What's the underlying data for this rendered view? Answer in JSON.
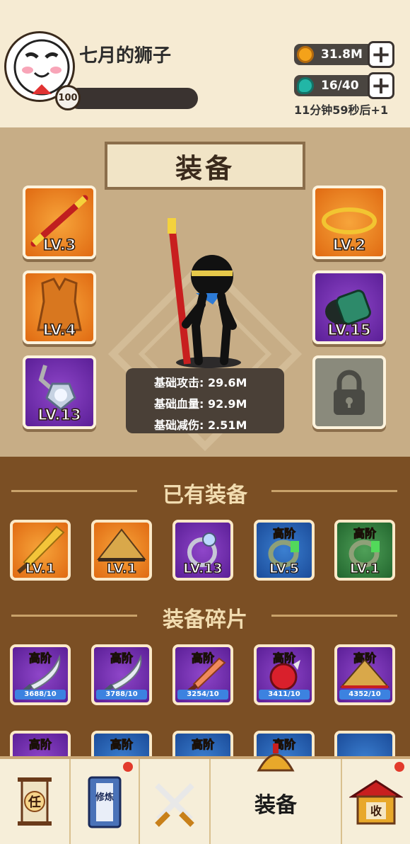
{
  "player": {
    "name": "七月的狮子",
    "level": "100"
  },
  "resources": {
    "coins": "31.8M",
    "energy": "16/40",
    "regen_timer": "11分钟59秒后+1"
  },
  "equip_panel": {
    "title": "装备",
    "slots_left": [
      {
        "name": "staff",
        "level": "LV.3",
        "rarity": "orange"
      },
      {
        "name": "armor",
        "level": "LV.4",
        "rarity": "orange"
      },
      {
        "name": "necklace",
        "level": "LV.13",
        "rarity": "purple"
      }
    ],
    "slots_right": [
      {
        "name": "headband",
        "level": "LV.2",
        "rarity": "orange"
      },
      {
        "name": "bracer",
        "level": "LV.15",
        "rarity": "purple"
      }
    ],
    "stats": {
      "attack": "基础攻击: 29.6M",
      "health": "基础血量: 92.9M",
      "defense": "基础减伤: 2.51M"
    }
  },
  "owned_equipment": {
    "title": "已有装备",
    "items": [
      {
        "icon": "sword-icon",
        "level": "LV.1",
        "rarity": "orange",
        "tier": ""
      },
      {
        "icon": "hat-icon",
        "level": "LV.1",
        "rarity": "orange",
        "tier": ""
      },
      {
        "icon": "ring-icon",
        "level": "LV.13",
        "rarity": "purple",
        "tier": ""
      },
      {
        "icon": "bracelet-icon",
        "level": "LV.5",
        "rarity": "blue",
        "tier": "高阶"
      },
      {
        "icon": "bracelet-icon",
        "level": "LV.1",
        "rarity": "green",
        "tier": "高阶"
      }
    ]
  },
  "fragments": {
    "title": "装备碎片",
    "items": [
      {
        "icon": "blade-icon",
        "tier": "高阶",
        "progress": "3688/10"
      },
      {
        "icon": "blade-icon",
        "tier": "高阶",
        "progress": "3788/10"
      },
      {
        "icon": "sword-icon",
        "tier": "高阶",
        "progress": "3254/10"
      },
      {
        "icon": "gauntlet-icon",
        "tier": "高阶",
        "progress": "3411/10"
      },
      {
        "icon": "hat-icon",
        "tier": "高阶",
        "progress": "4352/10"
      }
    ],
    "partial_row_tiers": [
      "高阶",
      "高阶",
      "高阶",
      "高阶"
    ]
  },
  "nav": {
    "task_label": "任",
    "cultivate_label": "修炼",
    "equip_label": "装备",
    "collect_label": "收"
  },
  "colors": {
    "panel": "#c7ad86",
    "inventory": "#7b4f24",
    "orange": "#f29a33",
    "purple": "#7a36b5",
    "blue": "#2e66bc",
    "green": "#3a8a45"
  }
}
